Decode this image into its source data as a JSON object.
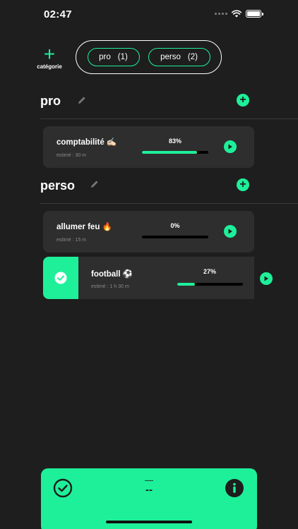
{
  "status": {
    "time": "02:47"
  },
  "top": {
    "add_category_label": "catégorie",
    "filters": [
      {
        "name": "pro",
        "count": "(1)"
      },
      {
        "name": "perso",
        "count": "(2)"
      }
    ]
  },
  "sections": [
    {
      "title": "pro",
      "tasks": [
        {
          "name": "comptabilité ✍🏻",
          "estimate": "estimé : 30 m",
          "percent_label": "83%",
          "progress": 0.83,
          "done": false
        }
      ]
    },
    {
      "title": "perso",
      "tasks": [
        {
          "name": "allumer feu 🔥",
          "estimate": "estimé : 15 m",
          "percent_label": "0%",
          "progress": 0.0,
          "done": false
        },
        {
          "name": "football ⚽",
          "estimate": "estimé : 1 h 30 m",
          "percent_label": "27%",
          "progress": 0.27,
          "done": true
        }
      ]
    }
  ],
  "bottom": {
    "timer_top": "----",
    "timer_main": "--"
  },
  "colors": {
    "accent": "#1ef09a",
    "background": "#1e1e1e",
    "card": "#2e2e2e"
  },
  "icons": [
    "plus-icon",
    "pencil-icon",
    "play-icon",
    "check-icon",
    "info-icon",
    "check-circle-icon"
  ]
}
